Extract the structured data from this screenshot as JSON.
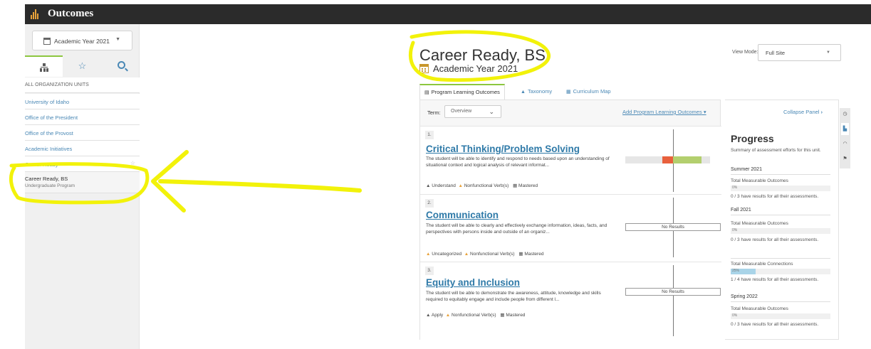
{
  "app": {
    "title": "Outcomes"
  },
  "sidebar": {
    "year_select": "Academic Year 2021",
    "all_units_label": "ALL ORGANIZATION UNITS",
    "items": [
      {
        "label": "University of Idaho"
      },
      {
        "label": "Office of the President"
      },
      {
        "label": "Office of the Provost"
      },
      {
        "label": "Academic Initiatives"
      },
      {
        "label": "Career Ready"
      }
    ],
    "selected": {
      "label": "Career Ready, BS",
      "sub": "Undergraduate Program"
    }
  },
  "header": {
    "title": "Career Ready, BS",
    "subtitle": "Academic Year 2021",
    "view_mode_label": "View Mode:",
    "view_mode_value": "Full Site"
  },
  "tabs": [
    {
      "label": "Program Learning Outcomes"
    },
    {
      "label": "Taxonomy"
    },
    {
      "label": "Curriculum Map"
    }
  ],
  "panel": {
    "term_label": "Term:",
    "term_value": "Overview",
    "add_link": "Add Program Learning Outcomes"
  },
  "outcomes": [
    {
      "num": "1.",
      "title": "Critical Thinking/Problem Solving",
      "desc": "The student will be able to identify and respond to needs based upon an understanding of situational context and logical analysis of relevant informat...",
      "tag1": "Understand",
      "tag2": "Nonfunctional Verb(s)",
      "tag3": "Mastered"
    },
    {
      "num": "2.",
      "title": "Communication",
      "desc": "The student will be able to clearly and effectively exchange information, ideas, facts, and perspectives with persons inside and outside of an organiz...",
      "tag1": "Uncategorized",
      "tag2": "Nonfunctional Verb(s)",
      "tag3": "Mastered",
      "result": "No Results"
    },
    {
      "num": "3.",
      "title": "Equity and Inclusion",
      "desc": "The student will be able to demonstrate the awareness, attitude, knowledge and skills required to equitably engage and include people from different l...",
      "tag1": "Apply",
      "tag2": "Nonfunctional Verb(s)",
      "tag3": "Mastered",
      "result": "No Results"
    }
  ],
  "progress": {
    "collapse": "Collapse Panel",
    "title": "Progress",
    "summary": "Summary of assessment efforts for this unit.",
    "terms": [
      {
        "name": "Summer 2021",
        "metric": "Total Measurable Outcomes",
        "pct": "0%",
        "note": "0 / 3 have results for all their assessments."
      },
      {
        "name": "Fall 2021",
        "metric": "Total Measurable Outcomes",
        "pct": "0%",
        "note": "0 / 3 have results for all their assessments.",
        "metric2": "Total Measurable Connections",
        "pct2": "25%",
        "note2": "1 / 4 have results for all their assessments."
      },
      {
        "name": "Spring 2022",
        "metric": "Total Measurable Outcomes",
        "pct": "0%",
        "note": "0 / 3 have results for all their assessments."
      }
    ]
  },
  "colors": {
    "accent_green": "#8cc63f",
    "link_blue": "#4a88b5",
    "annotation_yellow": "#f2f20a",
    "topbar": "#2b2b2b"
  }
}
